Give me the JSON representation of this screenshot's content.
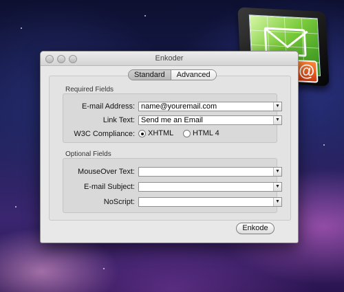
{
  "window": {
    "title": "Enkoder"
  },
  "tabs": [
    "Standard",
    "Advanced"
  ],
  "required": {
    "group_label": "Required Fields",
    "email_label": "E-mail Address:",
    "email_value": "name@youremail.com",
    "link_label": "Link Text:",
    "link_value": "Send me an Email",
    "w3c_label": "W3C Compliance:",
    "options": [
      "XHTML",
      "HTML 4"
    ],
    "selected": "XHTML"
  },
  "optional": {
    "group_label": "Optional Fields",
    "mouseover_label": "MouseOver Text:",
    "mouseover_value": "",
    "subject_label": "E-mail Subject:",
    "subject_value": "",
    "noscript_label": "NoScript:",
    "noscript_value": ""
  },
  "actions": {
    "enkode_label": "Enkode"
  },
  "icon": {
    "name": "enkoder-app-icon",
    "badge": "@"
  }
}
